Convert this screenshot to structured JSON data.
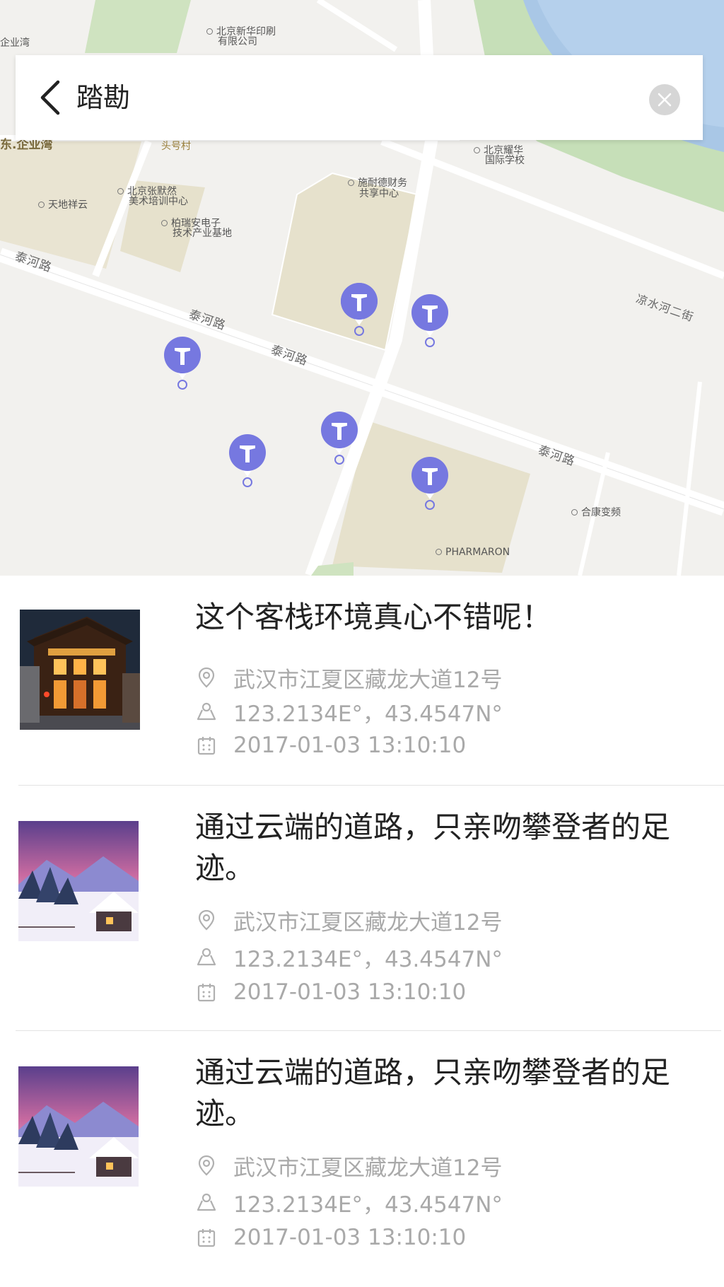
{
  "header": {
    "title": "踏勘"
  },
  "map": {
    "labels": {
      "l1": "企业湾",
      "l2": "北京新华印刷",
      "l2b": "有限公司",
      "l3": "头号村",
      "l4": "东.企业湾",
      "l5": "北京耀华",
      "l5b": "国际学校",
      "l6": "施耐德财务",
      "l6b": "共享中心",
      "l7": "北京张默然",
      "l7b": "美术培训中心",
      "l8": "天地祥云",
      "l9": "柏瑞安电子",
      "l9b": "技术产业基地",
      "r1": "泰河路",
      "r2": "泰河路",
      "r3": "泰河路",
      "r4": "泰河路",
      "r5": "凉水河二街",
      "l10": "合康变频",
      "l11": "PHARMARON"
    },
    "accent_color": "#7678e0"
  },
  "list": [
    {
      "title": "这个客栈环境真心不错呢！",
      "address": "武汉市江夏区藏龙大道12号",
      "coords": "123.2134E°，43.4547N°",
      "datetime": "2017-01-03  13:10:10",
      "thumb": "inn-photo"
    },
    {
      "title": "通过云端的道路，只亲吻攀登者的足迹。",
      "address": "武汉市江夏区藏龙大道12号",
      "coords": "123.2134E°，43.4547N°",
      "datetime": "2017-01-03  13:10:10",
      "thumb": "snow-cabin-photo"
    },
    {
      "title": "通过云端的道路，只亲吻攀登者的足迹。",
      "address": "武汉市江夏区藏龙大道12号",
      "coords": "123.2134E°，43.4547N°",
      "datetime": "2017-01-03  13:10:10",
      "thumb": "snow-cabin-photo"
    }
  ]
}
